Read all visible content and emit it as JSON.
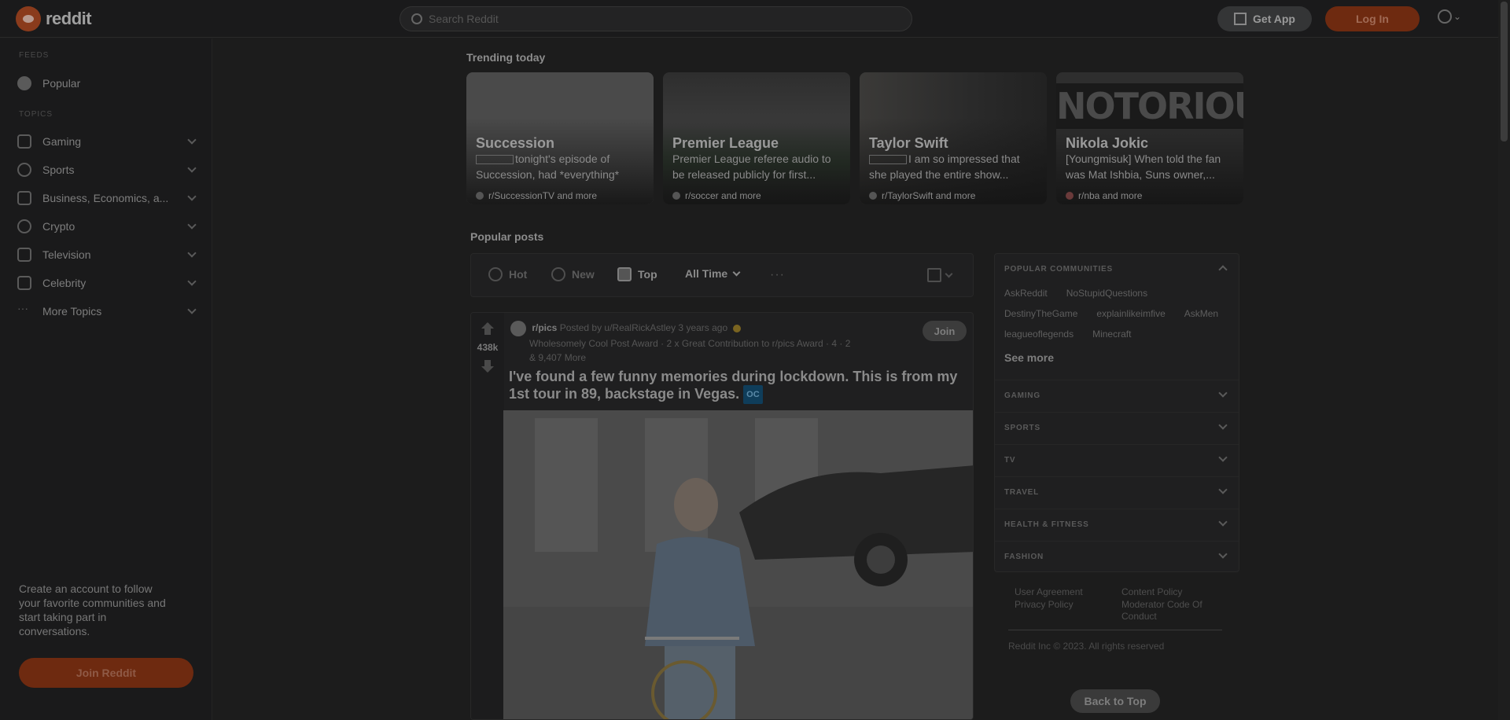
{
  "header": {
    "logo_text": "reddit",
    "search_placeholder": "Search Reddit",
    "get_app_label": "Get App",
    "login_label": "Log In"
  },
  "sidebar": {
    "feeds_label": "FEEDS",
    "popular_label": "Popular",
    "topics_label": "TOPICS",
    "topics": [
      {
        "label": "Gaming",
        "icon": "gamepad-icon"
      },
      {
        "label": "Sports",
        "icon": "ball-icon"
      },
      {
        "label": "Business, Economics, a...",
        "icon": "chart-icon"
      },
      {
        "label": "Crypto",
        "icon": "crypto-icon"
      },
      {
        "label": "Television",
        "icon": "tv-icon"
      },
      {
        "label": "Celebrity",
        "icon": "star-icon"
      },
      {
        "label": "More Topics",
        "icon": "dots-icon"
      }
    ],
    "cta_text": "Create an account to follow your favorite communities and start taking part in conversations.",
    "join_label": "Join Reddit"
  },
  "trending": {
    "title": "Trending today",
    "cards": [
      {
        "title": "Succession",
        "desc": "tonight's episode of Succession, had *everything*",
        "source": "r/SuccessionTV and more"
      },
      {
        "title": "Premier League",
        "desc": "Premier League referee audio to be released publicly for first...",
        "source": "r/soccer and more"
      },
      {
        "title": "Taylor Swift",
        "desc": "I am so impressed that she played the entire show...",
        "source": "r/TaylorSwift and more"
      },
      {
        "title": "Nikola Jokic",
        "desc": "[Youngmisuk] When told the fan was Mat Ishbia, Suns owner,...",
        "source": "r/nba and more"
      }
    ]
  },
  "feed": {
    "popular_title": "Popular posts",
    "sort": {
      "hot": "Hot",
      "new": "New",
      "top": "Top",
      "time": "All Time",
      "more": "···"
    }
  },
  "post": {
    "votes": "438k",
    "subreddit": "r/pics",
    "posted_by": "Posted by u/RealRickAstley 3 years ago",
    "awards_line": "Wholesomely Cool Post Award · 2 x Great Contribution to r/pics Award · 4 · 2",
    "more_awards": "& 9,407 More",
    "join_label": "Join",
    "title": "I've found a few funny memories during lockdown. This is from my 1st tour in 89, backstage in Vegas.",
    "flair": "OC"
  },
  "right": {
    "popular_communities": "POPULAR COMMUNITIES",
    "communities": [
      "AskReddit",
      "NoStupidQuestions",
      "DestinyTheGame",
      "explainlikeimfive",
      "AskMen",
      "leagueoflegends",
      "Minecraft"
    ],
    "see_more": "See more",
    "sections": [
      "GAMING",
      "SPORTS",
      "TV",
      "TRAVEL",
      "HEALTH & FITNESS",
      "FASHION"
    ]
  },
  "footer": {
    "user_agreement": "User Agreement",
    "privacy_policy": "Privacy Policy",
    "content_policy": "Content Policy",
    "moderator_code": "Moderator Code Of Conduct",
    "copyright": "Reddit Inc © 2023. All rights reserved",
    "back_to_top": "Back to Top"
  }
}
